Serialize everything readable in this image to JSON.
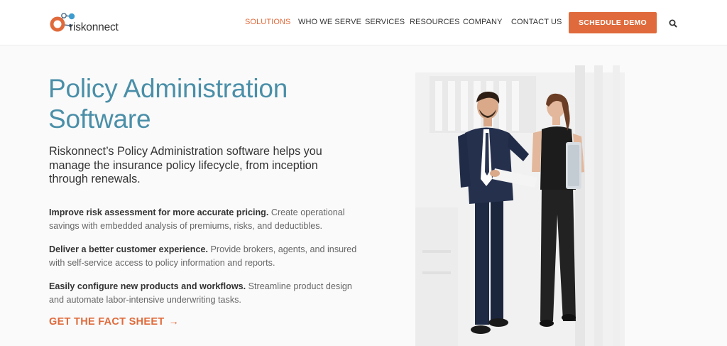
{
  "header": {
    "brand": "riskonnect",
    "nav": [
      {
        "label": "SOLUTIONS",
        "active": true
      },
      {
        "label": "WHO WE SERVE",
        "active": false
      },
      {
        "label": "SERVICES",
        "active": false
      },
      {
        "label": "RESOURCES",
        "active": false
      },
      {
        "label": "COMPANY",
        "active": false
      },
      {
        "label": "CONTACT US",
        "active": false
      }
    ],
    "cta_label": "SCHEDULE DEMO",
    "search_icon": "search-icon"
  },
  "main": {
    "title_line1": "Policy Administration",
    "title_line2": "Software",
    "lede": "Riskonnect’s Policy Administration software helps you manage the insurance policy lifecycle, from inception through renewals.",
    "bullets": [
      {
        "lead": "Improve risk assessment for more accurate pricing.",
        "text": " Create operational savings with embedded analysis of premiums, risks, and deductibles."
      },
      {
        "lead": "Deliver a better customer experience.",
        "text": " Provide brokers, agents, and insured with self-service access to policy information and reports."
      },
      {
        "lead": "Easily configure new products and workflows.",
        "text": " Streamline product design and automate labor-intensive underwriting tasks."
      }
    ],
    "cta": "GET THE FACT SHEET",
    "cta_arrow": "→"
  },
  "colors": {
    "accent": "#e06a3b",
    "title": "#4a8fa8",
    "logo_blue": "#3d9ccf"
  }
}
